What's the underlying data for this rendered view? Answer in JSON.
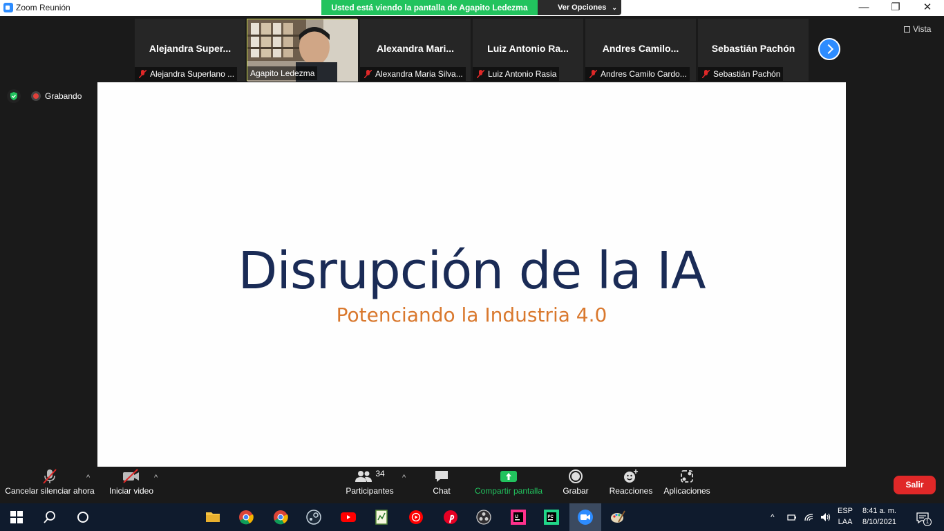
{
  "window": {
    "title": "Zoom Reunión",
    "controls": [
      "—",
      "❐",
      "✕"
    ]
  },
  "banner": {
    "viewing": "Usted está viendo la pantalla de Agapito Ledezma",
    "options": "Ver Opciones"
  },
  "participants": [
    {
      "display": "Alejandra  Super...",
      "label": "Alejandra Superlano ...",
      "muted": true
    },
    {
      "display": "",
      "label": "Agapito Ledezma",
      "muted": false,
      "video": true
    },
    {
      "display": "Alexandra  Mari...",
      "label": "Alexandra Maria Silva...",
      "muted": true
    },
    {
      "display": "Luiz  Antonio  Ra...",
      "label": "Luiz Antonio Rasia",
      "muted": true
    },
    {
      "display": "Andres  Camilo...",
      "label": "Andres Camilo Cardo...",
      "muted": true
    },
    {
      "display": "Sebastián Pachón",
      "label": "Sebastián Pachón",
      "muted": true
    }
  ],
  "view_button": "Vista",
  "recording": {
    "label": "Grabando"
  },
  "slide": {
    "title": "Disrupción de la IA",
    "subtitle": "Potenciando la Industria 4.0"
  },
  "controls": {
    "mute": "Cancelar silenciar ahora",
    "video": "Iniciar video",
    "participants": "Participantes",
    "participants_count": "34",
    "chat": "Chat",
    "share": "Compartir pantalla",
    "record": "Grabar",
    "reactions": "Reacciones",
    "apps": "Aplicaciones",
    "leave": "Salir"
  },
  "taskbar": {
    "lang_top": "ESP",
    "lang_bottom": "LAA",
    "time": "8:41 a. m.",
    "date": "8/10/2021",
    "notifications": "1"
  },
  "colors": {
    "banner_green": "#22c35e",
    "zoom_blue": "#2d8cff",
    "leave_red": "#e02828",
    "slide_title": "#1a2b56",
    "slide_subtitle": "#d9782d"
  }
}
